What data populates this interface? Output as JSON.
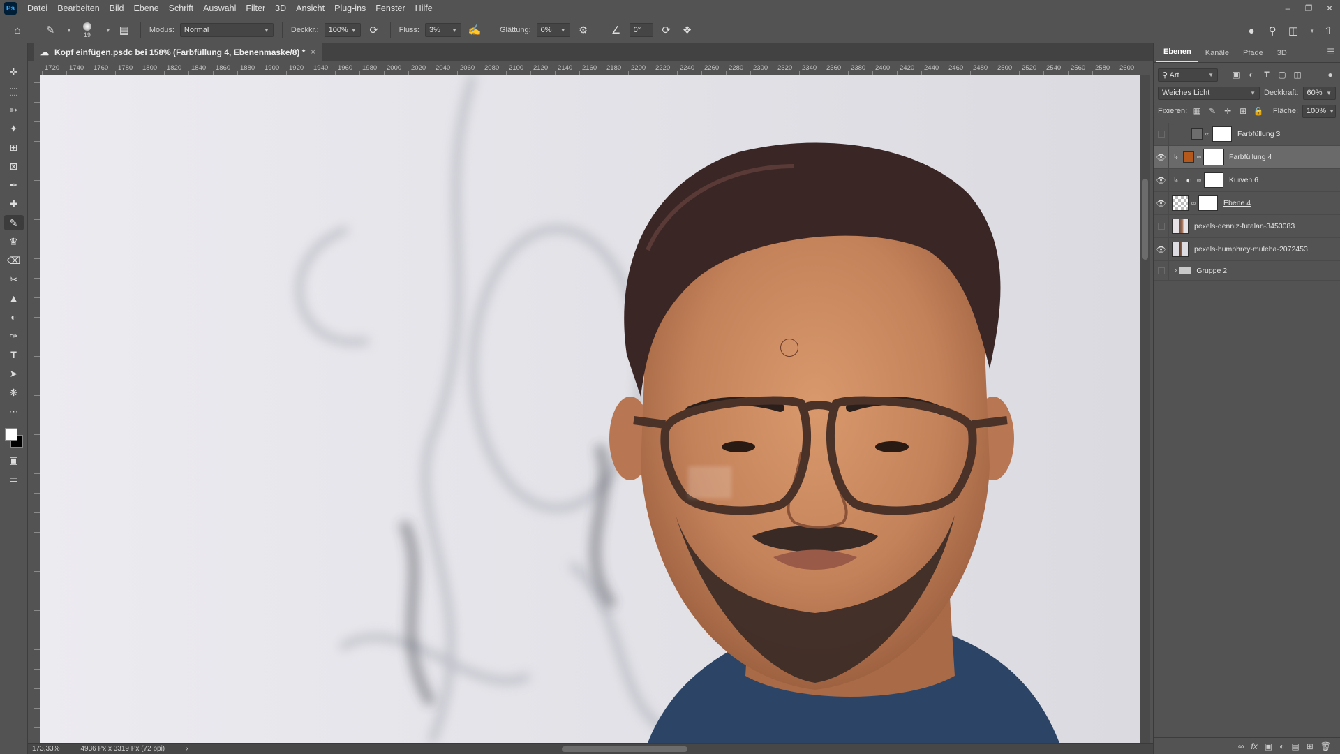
{
  "app": {
    "logo": "Ps"
  },
  "menu": [
    "Datei",
    "Bearbeiten",
    "Bild",
    "Ebene",
    "Schrift",
    "Auswahl",
    "Filter",
    "3D",
    "Ansicht",
    "Plug-ins",
    "Fenster",
    "Hilfe"
  ],
  "options": {
    "brush_size": "19",
    "mode_label": "Modus:",
    "mode_value": "Normal",
    "opacity_label": "Deckkr.:",
    "opacity_value": "100%",
    "flow_label": "Fluss:",
    "flow_value": "3%",
    "smoothing_label": "Glättung:",
    "smoothing_value": "0%",
    "angle_value": "0°"
  },
  "document": {
    "tab_title": "Kopf einfügen.psdc bei 158% (Farbfüllung 4, Ebenenmaske/8) *",
    "close": "×"
  },
  "ruler": [
    "1720",
    "1740",
    "1760",
    "1780",
    "1800",
    "1820",
    "1840",
    "1860",
    "1880",
    "1900",
    "1920",
    "1940",
    "1960",
    "1980",
    "2000",
    "2020",
    "2040",
    "2060",
    "2080",
    "2100",
    "2120",
    "2140",
    "2160",
    "2180",
    "2200",
    "2220",
    "2240",
    "2260",
    "2280",
    "2300",
    "2320",
    "2340",
    "2360",
    "2380",
    "2400",
    "2420",
    "2440",
    "2460",
    "2480",
    "2500",
    "2520",
    "2540",
    "2560",
    "2580",
    "2600"
  ],
  "status": {
    "zoom": "173,33%",
    "doc_size": "4936 Px x 3319 Px (72 ppi)"
  },
  "panel": {
    "tabs": [
      "Ebenen",
      "Kanäle",
      "Pfade",
      "3D"
    ],
    "filter_label": "Art",
    "blend_mode": "Weiches Licht",
    "opacity_label": "Deckkraft:",
    "opacity_value": "60%",
    "lock_label": "Fixieren:",
    "fill_label": "Fläche:",
    "fill_value": "100%",
    "layers": [
      {
        "name": "Farbfüllung 3",
        "visible": false,
        "swatch": "#6d6d6d"
      },
      {
        "name": "Farbfüllung 4",
        "visible": true,
        "swatch": "#b4581c",
        "selected": true
      },
      {
        "name": "Kurven 6",
        "visible": true
      },
      {
        "name": "Ebene 4",
        "visible": true
      },
      {
        "name": "pexels-denniz-futalan-3453083",
        "visible": false
      },
      {
        "name": "pexels-humphrey-muleba-2072453",
        "visible": true
      },
      {
        "name": "Gruppe 2",
        "visible": false
      }
    ]
  },
  "colors": {
    "foreground": "#ffffff",
    "background": "#000000",
    "accent": "#b4581c"
  }
}
